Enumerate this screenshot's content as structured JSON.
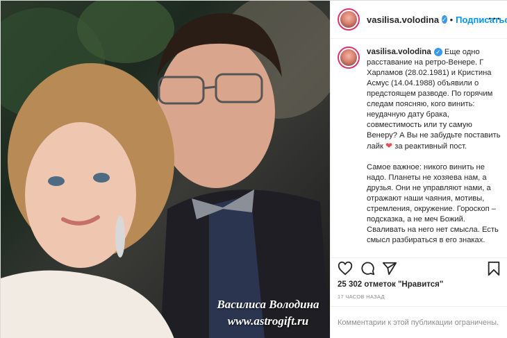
{
  "post": {
    "username": "vasilisa.volodina",
    "follow_label": "Подписаться",
    "dot": "•",
    "caption": {
      "p1": "Еще одно расставание на ретро-Венере. Г Харламов (28.02.1981) и Кристина Асмус (14.04.1988) объявили о предстоящем разводе. По горячим следам поясняю, кого винить: неудачную дату брака, совместимость или ту самую Венеру? А Вы не забудьте поставить лайк",
      "p1_end": "за реактивный пост.",
      "p2": "Самое важное: никого винить не надо. Планеты не хозяева нам, а друзья. Они не управляют нами, а отражают наши чаяния, мотивы, стремления, окружение. Гороскоп – подсказка, а не меч Божий. Сваливать на него нет смысла. Есть смысл разбираться в его знаках."
    },
    "likes": "25 302 отметок \"Нравится\"",
    "timestamp": "17 ЧАСОВ НАЗАД",
    "comments_note": "Комментарии к этой публикации ограничены."
  },
  "photo": {
    "watermark_name": "Василиса Володина",
    "watermark_site": "www.astrogift.ru"
  },
  "icons": [
    "heart-outline-icon",
    "comment-icon",
    "send-icon",
    "bookmark-icon",
    "more-icon",
    "verified-badge-icon",
    "heart-emoji-icon"
  ],
  "colors": {
    "link_blue": "#0095f6",
    "verified_blue": "#3897f0",
    "heart_red": "#ed4956",
    "muted_gray": "#8e8e8e",
    "text": "#262626"
  }
}
